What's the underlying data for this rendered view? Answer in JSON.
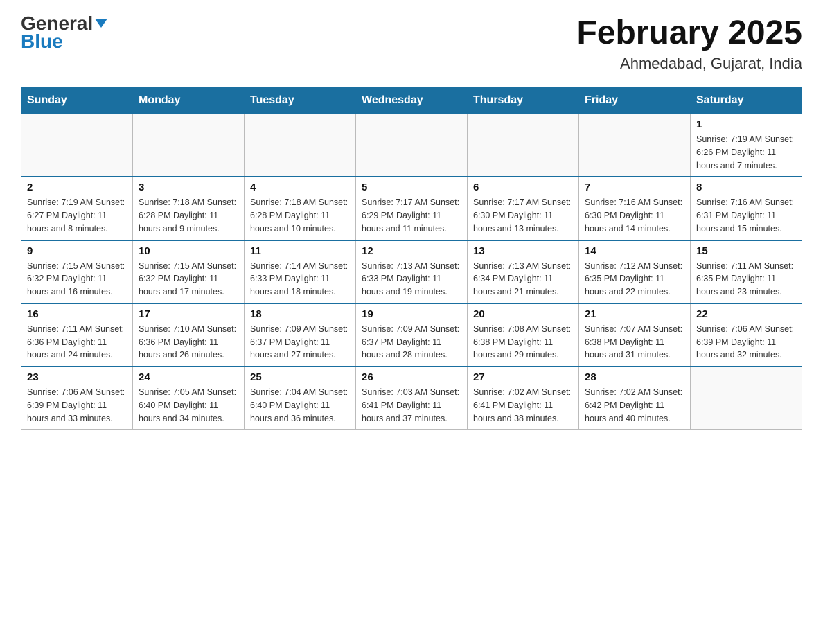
{
  "header": {
    "logo_general": "General",
    "logo_blue": "Blue",
    "month_title": "February 2025",
    "location": "Ahmedabad, Gujarat, India"
  },
  "days_of_week": [
    "Sunday",
    "Monday",
    "Tuesday",
    "Wednesday",
    "Thursday",
    "Friday",
    "Saturday"
  ],
  "weeks": [
    [
      {
        "day": "",
        "info": ""
      },
      {
        "day": "",
        "info": ""
      },
      {
        "day": "",
        "info": ""
      },
      {
        "day": "",
        "info": ""
      },
      {
        "day": "",
        "info": ""
      },
      {
        "day": "",
        "info": ""
      },
      {
        "day": "1",
        "info": "Sunrise: 7:19 AM\nSunset: 6:26 PM\nDaylight: 11 hours and 7 minutes."
      }
    ],
    [
      {
        "day": "2",
        "info": "Sunrise: 7:19 AM\nSunset: 6:27 PM\nDaylight: 11 hours and 8 minutes."
      },
      {
        "day": "3",
        "info": "Sunrise: 7:18 AM\nSunset: 6:28 PM\nDaylight: 11 hours and 9 minutes."
      },
      {
        "day": "4",
        "info": "Sunrise: 7:18 AM\nSunset: 6:28 PM\nDaylight: 11 hours and 10 minutes."
      },
      {
        "day": "5",
        "info": "Sunrise: 7:17 AM\nSunset: 6:29 PM\nDaylight: 11 hours and 11 minutes."
      },
      {
        "day": "6",
        "info": "Sunrise: 7:17 AM\nSunset: 6:30 PM\nDaylight: 11 hours and 13 minutes."
      },
      {
        "day": "7",
        "info": "Sunrise: 7:16 AM\nSunset: 6:30 PM\nDaylight: 11 hours and 14 minutes."
      },
      {
        "day": "8",
        "info": "Sunrise: 7:16 AM\nSunset: 6:31 PM\nDaylight: 11 hours and 15 minutes."
      }
    ],
    [
      {
        "day": "9",
        "info": "Sunrise: 7:15 AM\nSunset: 6:32 PM\nDaylight: 11 hours and 16 minutes."
      },
      {
        "day": "10",
        "info": "Sunrise: 7:15 AM\nSunset: 6:32 PM\nDaylight: 11 hours and 17 minutes."
      },
      {
        "day": "11",
        "info": "Sunrise: 7:14 AM\nSunset: 6:33 PM\nDaylight: 11 hours and 18 minutes."
      },
      {
        "day": "12",
        "info": "Sunrise: 7:13 AM\nSunset: 6:33 PM\nDaylight: 11 hours and 19 minutes."
      },
      {
        "day": "13",
        "info": "Sunrise: 7:13 AM\nSunset: 6:34 PM\nDaylight: 11 hours and 21 minutes."
      },
      {
        "day": "14",
        "info": "Sunrise: 7:12 AM\nSunset: 6:35 PM\nDaylight: 11 hours and 22 minutes."
      },
      {
        "day": "15",
        "info": "Sunrise: 7:11 AM\nSunset: 6:35 PM\nDaylight: 11 hours and 23 minutes."
      }
    ],
    [
      {
        "day": "16",
        "info": "Sunrise: 7:11 AM\nSunset: 6:36 PM\nDaylight: 11 hours and 24 minutes."
      },
      {
        "day": "17",
        "info": "Sunrise: 7:10 AM\nSunset: 6:36 PM\nDaylight: 11 hours and 26 minutes."
      },
      {
        "day": "18",
        "info": "Sunrise: 7:09 AM\nSunset: 6:37 PM\nDaylight: 11 hours and 27 minutes."
      },
      {
        "day": "19",
        "info": "Sunrise: 7:09 AM\nSunset: 6:37 PM\nDaylight: 11 hours and 28 minutes."
      },
      {
        "day": "20",
        "info": "Sunrise: 7:08 AM\nSunset: 6:38 PM\nDaylight: 11 hours and 29 minutes."
      },
      {
        "day": "21",
        "info": "Sunrise: 7:07 AM\nSunset: 6:38 PM\nDaylight: 11 hours and 31 minutes."
      },
      {
        "day": "22",
        "info": "Sunrise: 7:06 AM\nSunset: 6:39 PM\nDaylight: 11 hours and 32 minutes."
      }
    ],
    [
      {
        "day": "23",
        "info": "Sunrise: 7:06 AM\nSunset: 6:39 PM\nDaylight: 11 hours and 33 minutes."
      },
      {
        "day": "24",
        "info": "Sunrise: 7:05 AM\nSunset: 6:40 PM\nDaylight: 11 hours and 34 minutes."
      },
      {
        "day": "25",
        "info": "Sunrise: 7:04 AM\nSunset: 6:40 PM\nDaylight: 11 hours and 36 minutes."
      },
      {
        "day": "26",
        "info": "Sunrise: 7:03 AM\nSunset: 6:41 PM\nDaylight: 11 hours and 37 minutes."
      },
      {
        "day": "27",
        "info": "Sunrise: 7:02 AM\nSunset: 6:41 PM\nDaylight: 11 hours and 38 minutes."
      },
      {
        "day": "28",
        "info": "Sunrise: 7:02 AM\nSunset: 6:42 PM\nDaylight: 11 hours and 40 minutes."
      },
      {
        "day": "",
        "info": ""
      }
    ]
  ]
}
